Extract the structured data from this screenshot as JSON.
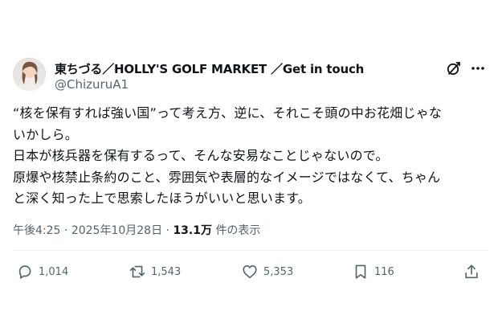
{
  "author": {
    "display_name": "東ちづる／HOLLY'S GOLF MARKET ／Get in touch",
    "handle": "@ChizuruA1"
  },
  "tweet": {
    "lines": [
      "“核を保有すれば強い国”って考え方、逆に、それこそ頭の中お花畑じゃな",
      "いかしら。",
      "日本が核兵器を保有するって、そんな安易なことじゃないので。",
      "原爆や核禁止条約のこと、雰囲気や表層的なイメージではなくて、ちゃん",
      "と深く知った上で思索したほうがいいと思います。"
    ]
  },
  "meta": {
    "time": "午後4:25",
    "separator": "·",
    "date": "2025年10月28日",
    "views": "13.1万",
    "views_suffix": "件の表示"
  },
  "actions": {
    "replies": "1,014",
    "reposts": "1,543",
    "likes": "5,353",
    "bookmarks": "116"
  },
  "icons": {
    "grok": "grok-icon",
    "more": "more-icon",
    "reply": "reply-icon",
    "repost": "repost-icon",
    "like": "heart-icon",
    "bookmark": "bookmark-icon",
    "share": "share-icon"
  },
  "colors": {
    "text": "#0f1419",
    "secondary": "#536471",
    "divider": "#eff3f4"
  }
}
